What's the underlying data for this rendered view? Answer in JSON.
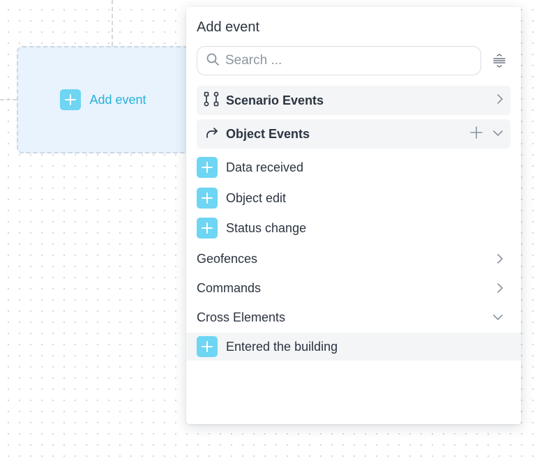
{
  "canvas": {
    "node_label": "Add event"
  },
  "panel": {
    "title": "Add event",
    "search_placeholder": "Search ...",
    "groups": [
      {
        "label": "Scenario Events",
        "icon": "branch-icon",
        "state": "collapsed"
      },
      {
        "label": "Object Events",
        "icon": "redirect-arrow-icon",
        "state": "expanded"
      }
    ],
    "object_events": [
      {
        "label": "Data received"
      },
      {
        "label": "Object edit"
      },
      {
        "label": "Status change"
      }
    ],
    "categories": [
      {
        "label": "Geofences",
        "state": "collapsed"
      },
      {
        "label": "Commands",
        "state": "collapsed"
      },
      {
        "label": "Cross Elements",
        "state": "expanded"
      }
    ],
    "cross_elements": [
      {
        "label": "Entered the building"
      }
    ]
  },
  "colors": {
    "accent": "#6ed5f3",
    "accent_text": "#27b1dc",
    "node_bg": "#e8f3fd",
    "header_bg": "#f3f5f7"
  }
}
